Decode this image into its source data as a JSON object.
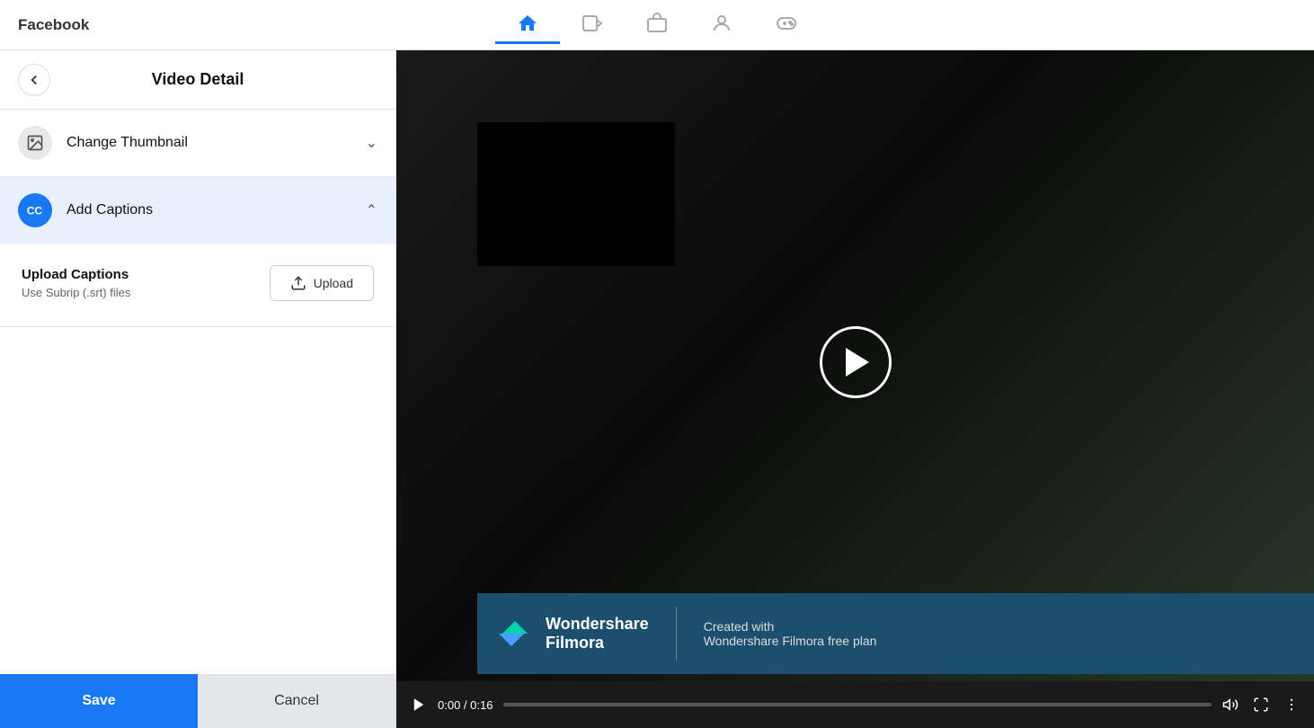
{
  "app": {
    "brand": "Facebook"
  },
  "topnav": {
    "icons": [
      {
        "name": "home",
        "label": "Home",
        "active": true
      },
      {
        "name": "video",
        "label": "Video",
        "active": false
      },
      {
        "name": "store",
        "label": "Store",
        "active": false
      },
      {
        "name": "profile",
        "label": "Profile",
        "active": false
      },
      {
        "name": "gaming",
        "label": "Gaming",
        "active": false
      }
    ]
  },
  "header": {
    "title": "Video Detail",
    "back_label": "←"
  },
  "sidebar": {
    "change_thumbnail": {
      "label": "Change Thumbnail",
      "expanded": false
    },
    "add_captions": {
      "label": "Add Captions",
      "expanded": true,
      "upload_title": "Upload Captions",
      "upload_sub": "Use Subrip (.srt) files",
      "upload_btn": "Upload"
    }
  },
  "buttons": {
    "save": "Save",
    "cancel": "Cancel"
  },
  "video": {
    "time": "0:00 / 0:16",
    "filmora": {
      "name": "Wondershare\nFilmora",
      "created": "Created with",
      "plan": "Wondershare Filmora free plan"
    }
  }
}
